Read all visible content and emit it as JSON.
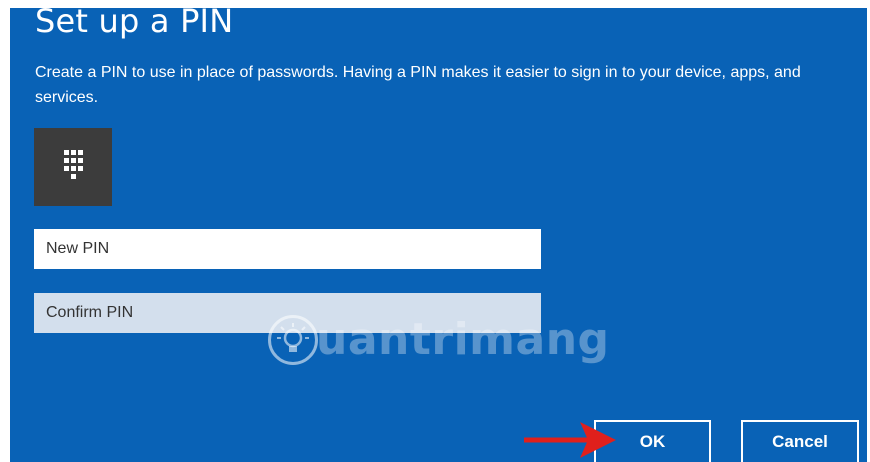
{
  "dialog": {
    "title": "Set up a PIN",
    "description": "Create a PIN to use in place of passwords. Having a PIN makes it easier to sign in to your device, apps, and services.",
    "pin_icon": "numeric-keypad-icon",
    "new_pin": {
      "placeholder": "New PIN",
      "value": ""
    },
    "confirm_pin": {
      "placeholder": "Confirm PIN",
      "value": ""
    },
    "ok_label": "OK",
    "cancel_label": "Cancel"
  },
  "watermark": {
    "text": "uantrimang",
    "icon": "lightbulb-icon"
  },
  "annotation": {
    "icon": "red-arrow-icon",
    "color": "#e0201c"
  },
  "colors": {
    "dialog_background": "#0962b6",
    "pin_tile": "#3c3c3c",
    "confirm_field": "#d3dfed",
    "text": "#ffffff"
  }
}
